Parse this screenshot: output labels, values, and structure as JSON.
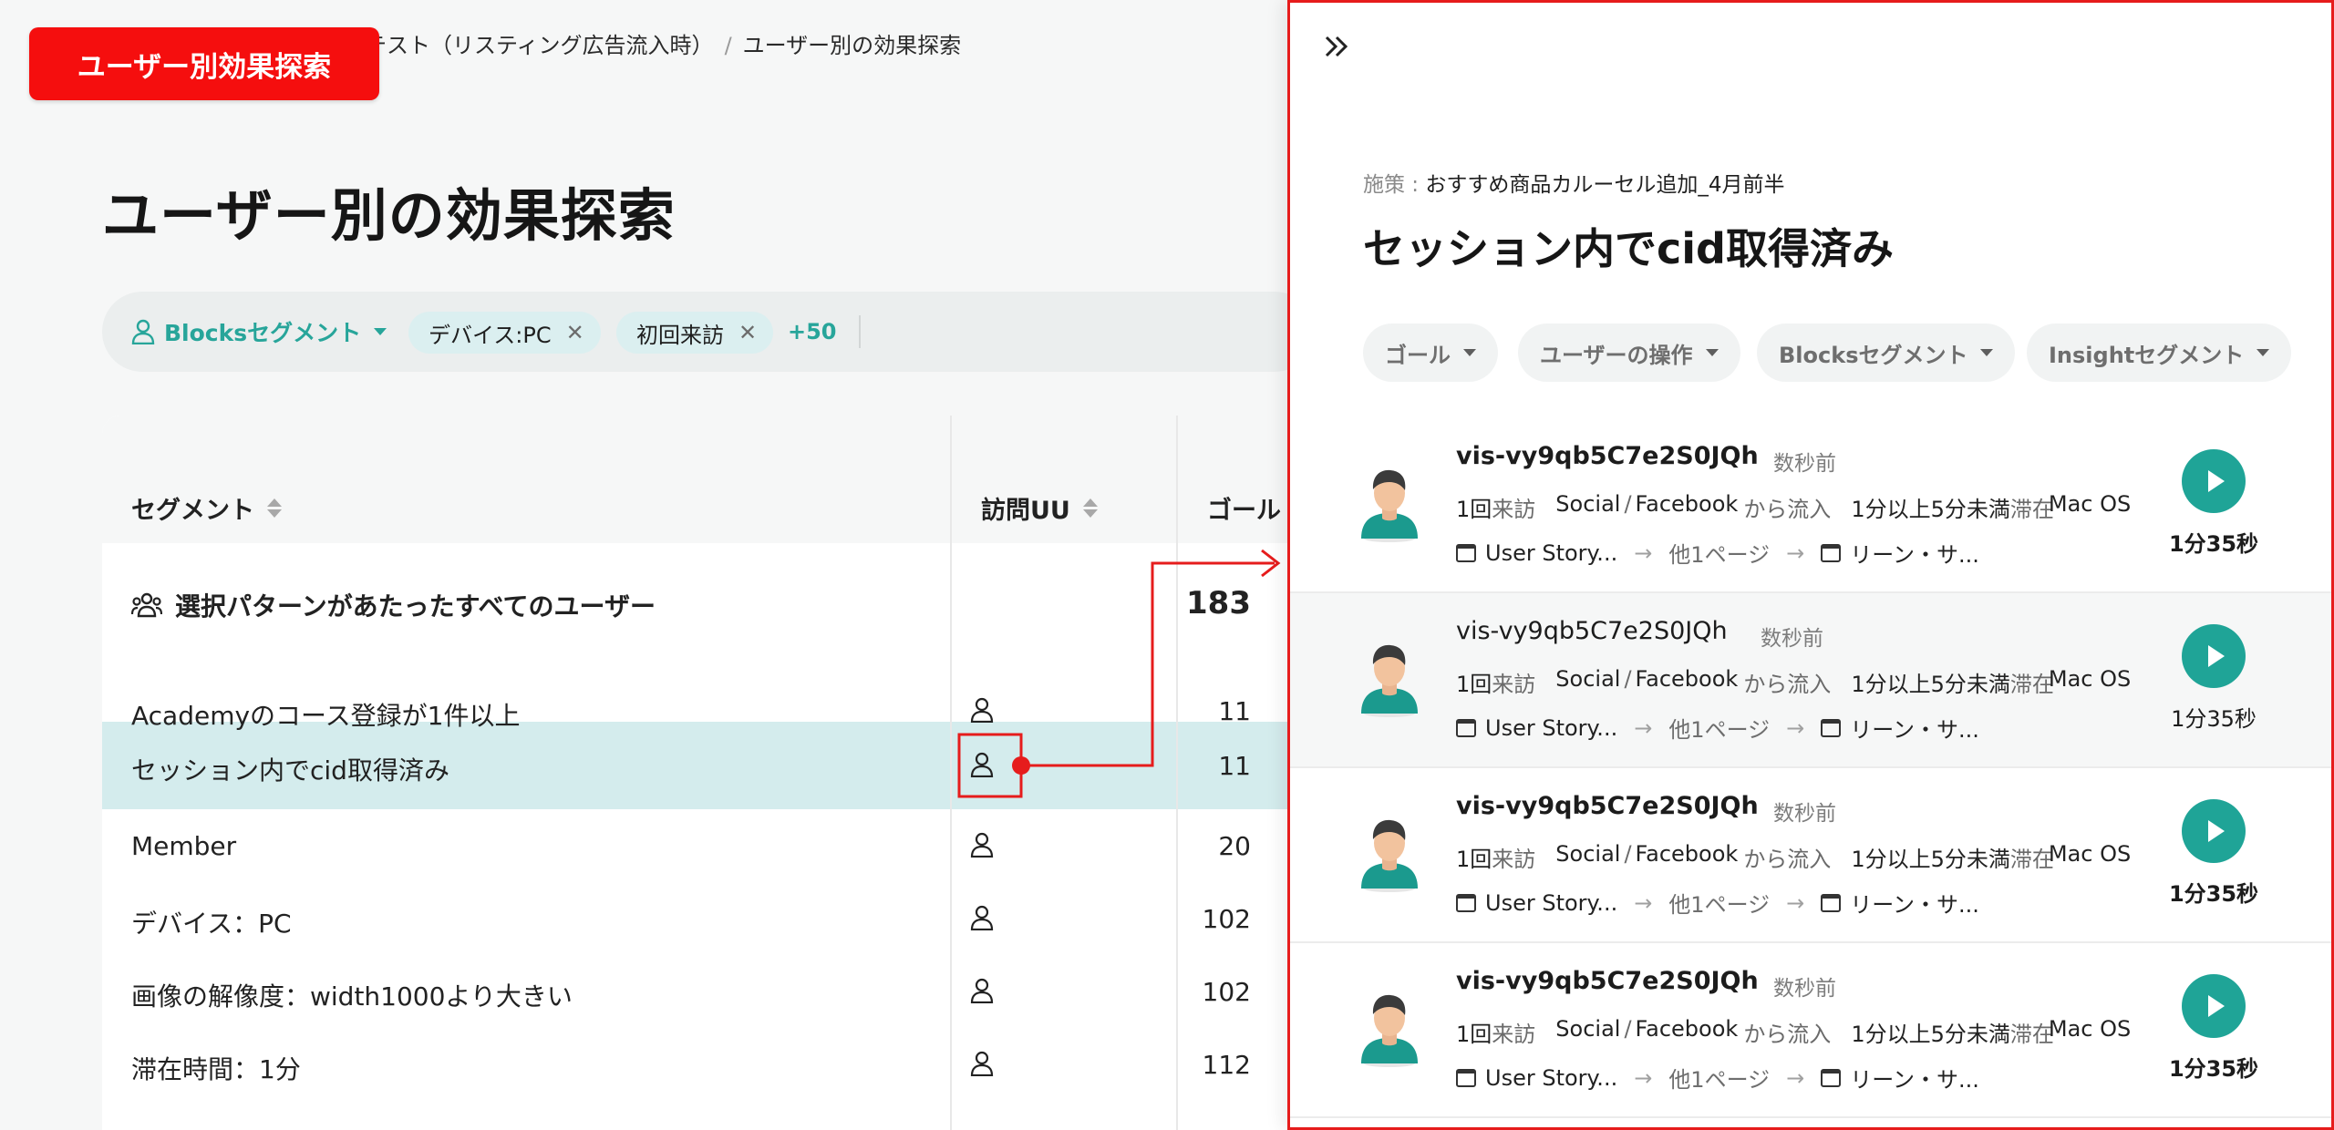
{
  "annotation": {
    "label": "ユーザー別効果探索"
  },
  "breadcrumb": {
    "parent": "テスト（リスティング広告流入時）",
    "sep": "/",
    "current": "ユーザー別の効果探索"
  },
  "page": {
    "title": "ユーザー別の効果探索"
  },
  "filters": {
    "segment_dropdown": "Blocksセグメント",
    "chips": [
      "デバイス:PC",
      "初回来訪"
    ],
    "more": "+50"
  },
  "table": {
    "headers": {
      "segment": "セグメント",
      "visits": "訪問UU",
      "goal": "ゴール"
    },
    "total": {
      "label": "選択パターンがあたったすべてのユーザー",
      "value": "183"
    },
    "rows": [
      {
        "name": "Academyのコース登録が1件以上",
        "value": "11"
      },
      {
        "name": "セッション内でcid取得済み",
        "value": "11"
      },
      {
        "name": "Member",
        "value": "20"
      },
      {
        "name": "デバイス：PC",
        "value": "102"
      },
      {
        "name": "画像の解像度：width1000より大きい",
        "value": "102"
      },
      {
        "name": "滞在時間：1分",
        "value": "112"
      }
    ],
    "selected_row_index": 1
  },
  "panel": {
    "measure_label": "施策 : ",
    "measure_value": "おすすめ商品カルーセル追加_4月前半",
    "title": "セッション内でcid取得済み",
    "filters": [
      "ゴール",
      "ユーザーの操作",
      "Blocksセグメント",
      "Insightセグメント"
    ],
    "visitors": [
      {
        "id": "vis-vy9qb5C7e2S0JQh",
        "time": "数秒前",
        "visits": "1回",
        "visits_suffix": "来訪",
        "source": "Social",
        "source_sep": "/",
        "source_detail": "Facebook",
        "source_suffix": "から流入",
        "stay": "1分以上5分未満",
        "stay_suffix": "滞在",
        "os": "Mac OS",
        "page_from": "User Story...",
        "page_mid": "他1ページ",
        "page_to": "リーン・サ...",
        "duration": "1分35秒"
      },
      {
        "id": "vis-vy9qb5C7e2S0JQh",
        "time": "数秒前",
        "visits": "1回",
        "visits_suffix": "来訪",
        "source": "Social",
        "source_sep": "/",
        "source_detail": "Facebook",
        "source_suffix": "から流入",
        "stay": "1分以上5分未満",
        "stay_suffix": "滞在",
        "os": "Mac OS",
        "page_from": "User Story...",
        "page_mid": "他1ページ",
        "page_to": "リーン・サ...",
        "duration": "1分35秒"
      },
      {
        "id": "vis-vy9qb5C7e2S0JQh",
        "time": "数秒前",
        "visits": "1回",
        "visits_suffix": "来訪",
        "source": "Social",
        "source_sep": "/",
        "source_detail": "Facebook",
        "source_suffix": "から流入",
        "stay": "1分以上5分未満",
        "stay_suffix": "滞在",
        "os": "Mac OS",
        "page_from": "User Story...",
        "page_mid": "他1ページ",
        "page_to": "リーン・サ...",
        "duration": "1分35秒"
      },
      {
        "id": "vis-vy9qb5C7e2S0JQh",
        "time": "数秒前",
        "visits": "1回",
        "visits_suffix": "来訪",
        "source": "Social",
        "source_sep": "/",
        "source_detail": "Facebook",
        "source_suffix": "から流入",
        "stay": "1分以上5分未満",
        "stay_suffix": "滞在",
        "os": "Mac OS",
        "page_from": "User Story...",
        "page_mid": "他1ページ",
        "page_to": "リーン・サ...",
        "duration": "1分35秒"
      }
    ]
  },
  "icons": {
    "arrow": "→",
    "remove": "✕"
  },
  "colors": {
    "accent": "#27a59a",
    "annotation": "#f50e0e",
    "selected_row": "#d4eced",
    "play": "#1fa497"
  }
}
